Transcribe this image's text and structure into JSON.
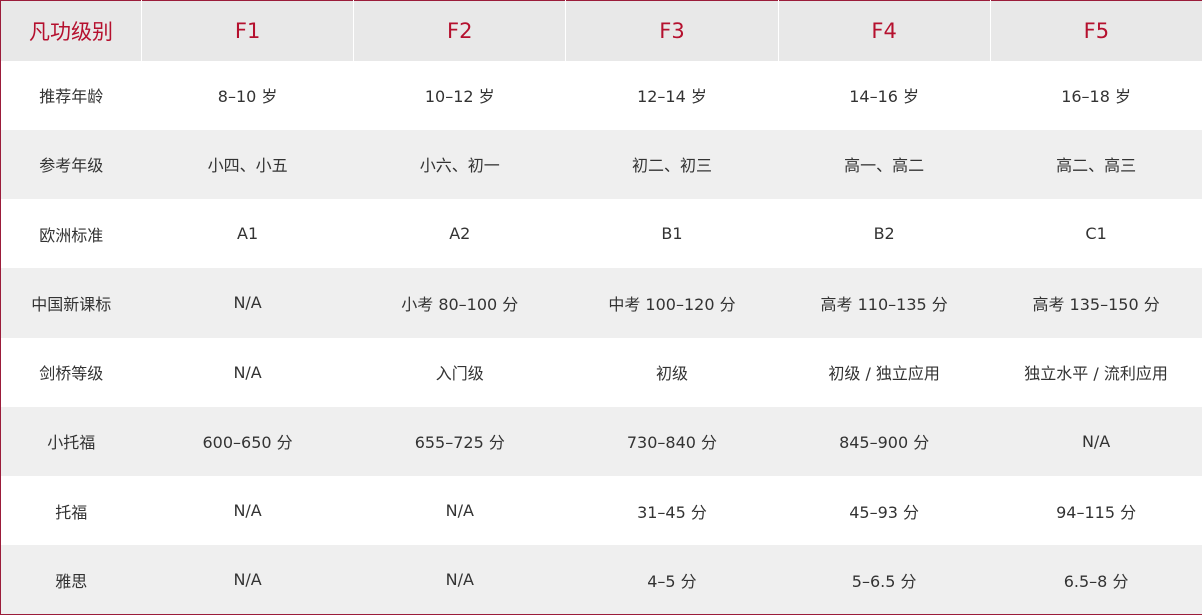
{
  "table": {
    "header": [
      "凡功级别",
      "F1",
      "F2",
      "F3",
      "F4",
      "F5"
    ],
    "rows": [
      [
        "推荐年龄",
        "8–10 岁",
        "10–12 岁",
        "12–14 岁",
        "14–16 岁",
        "16–18 岁"
      ],
      [
        "参考年级",
        "小四、小五",
        "小六、初一",
        "初二、初三",
        "高一、高二",
        "高二、高三"
      ],
      [
        "欧洲标准",
        "A1",
        "A2",
        "B1",
        "B2",
        "C1"
      ],
      [
        "中国新课标",
        "N/A",
        "小考 80–100 分",
        "中考 100–120 分",
        "高考 110–135 分",
        "高考 135–150 分"
      ],
      [
        "剑桥等级",
        "N/A",
        "入门级",
        "初级",
        "初级 / 独立应用",
        "独立水平 / 流利应用"
      ],
      [
        "小托福",
        "600–650 分",
        "655–725 分",
        "730–840 分",
        "845–900 分",
        "N/A"
      ],
      [
        "托福",
        "N/A",
        "N/A",
        "31–45 分",
        "45–93 分",
        "94–115 分"
      ],
      [
        "雅思",
        "N/A",
        "N/A",
        "4–5 分",
        "5–6.5 分",
        "6.5–8 分"
      ]
    ]
  },
  "colors": {
    "header_text": "#b5102e",
    "header_bg": "#e8e8e8",
    "stripe_bg": "#efefef",
    "border": "#9b1c3a"
  }
}
